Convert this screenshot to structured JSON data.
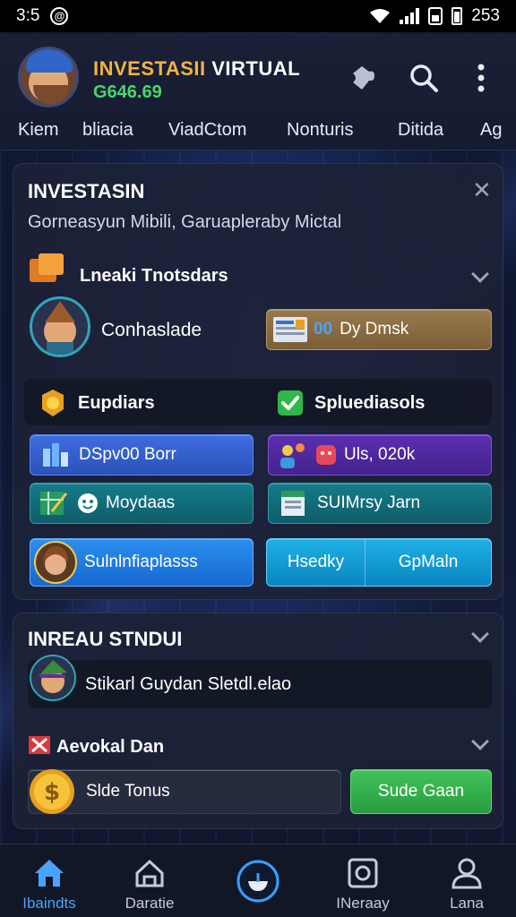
{
  "status_bar": {
    "time": "3:5",
    "at_symbol": "@",
    "right_value": "253"
  },
  "header": {
    "title_part1": "INVESTASII",
    "title_part2": "VIRTUAL",
    "balance": "G646.69",
    "icons": [
      "puzzle-icon",
      "search-icon",
      "more-vert-icon"
    ]
  },
  "nav_tabs": [
    {
      "label": "Kiem"
    },
    {
      "label": "bliacia"
    },
    {
      "label": "ViadCtom"
    },
    {
      "label": "Nonturis"
    },
    {
      "label": "Ditida"
    },
    {
      "label": "Ag"
    }
  ],
  "main_panel": {
    "title": "INVESTASIN",
    "subtitle": "Gorneasyun Mibili, Garuapleraby Mictal",
    "section1": {
      "title": "Lneaki Tnotsdars",
      "profile_label": "Conhaslade",
      "dy_button": "Dy Dmsk",
      "dy_prefix": "00"
    },
    "section2": {
      "left_title": "Eupdiars",
      "right_title": "Spluediasols",
      "buttons": [
        {
          "label": "DSpv00 Borr",
          "style": "blue"
        },
        {
          "label": "Uls, 020k",
          "style": "purple"
        },
        {
          "label": "Moydaas",
          "style": "teal"
        },
        {
          "label": "SUIMrsy Jarn",
          "style": "teal"
        },
        {
          "label": "Sulnlnfiaplasss",
          "style": "bright"
        }
      ],
      "split_button": {
        "left": "Hsedky",
        "right": "GpMaln"
      }
    }
  },
  "lower_panel": {
    "title": "INREAU STNDUI",
    "item1": "Stikarl Guydan Sletdl.elao",
    "section_title": "Aevokal Dan",
    "slide_label": "Slde Tonus",
    "green_button": "Sude Gaan"
  },
  "bottom_nav": [
    {
      "label": "Ibaindts",
      "icon": "home-icon",
      "active": true
    },
    {
      "label": "Daratie",
      "icon": "house-outline-icon",
      "active": false
    },
    {
      "label": "",
      "icon": "center-action-icon",
      "active": false
    },
    {
      "label": "INeraay",
      "icon": "camera-icon",
      "active": false
    },
    {
      "label": "Lana",
      "icon": "profile-icon",
      "active": false
    }
  ],
  "colors": {
    "accent_gold": "#f2b441",
    "balance_green": "#43d96a",
    "active_blue": "#4aa3ff",
    "panel_bg": "#1c2236"
  }
}
